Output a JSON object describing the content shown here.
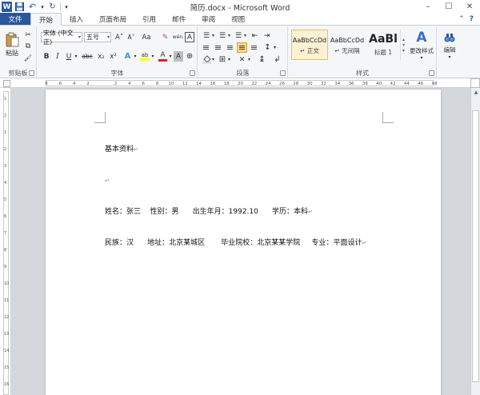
{
  "window": {
    "title": "简历.docx - Microsoft Word",
    "controls": {
      "minimize": "–",
      "maximize": "☐",
      "close": "✕"
    }
  },
  "qat": {
    "app_icon": "W",
    "save_icon": "💾",
    "undo_icon": "↶",
    "redo_icon": "↻",
    "more_icon": "▾"
  },
  "tabs": [
    {
      "label": "文件"
    },
    {
      "label": "开始"
    },
    {
      "label": "插入"
    },
    {
      "label": "页面布局"
    },
    {
      "label": "引用"
    },
    {
      "label": "邮件"
    },
    {
      "label": "审阅"
    },
    {
      "label": "视图"
    }
  ],
  "tab_right": {
    "minimize_ribbon": "⌃",
    "help": "?"
  },
  "ribbon": {
    "clipboard": {
      "label": "剪贴板",
      "paste_label": "粘贴",
      "cut_icon": "✂",
      "copy_icon": "⧉",
      "format_painter_icon": "🖌"
    },
    "font": {
      "label": "字体",
      "font_name": "宋体 (中文正)",
      "font_size": "五号",
      "grow": "A˄",
      "shrink": "A˅",
      "change_case": "Aa",
      "clear": "✎",
      "phonetic": "wén",
      "border_char": "A",
      "bold": "B",
      "italic": "I",
      "underline": "U",
      "strike": "abc",
      "subscript": "x₂",
      "superscript": "x²",
      "text_effect": "A",
      "highlight": "ab",
      "font_color": "A",
      "shade": "A",
      "encircle": "⊕"
    },
    "paragraph": {
      "label": "段落",
      "bullets": "☰",
      "numbering": "☰",
      "multilevel": "☰",
      "decrease_indent": "⇤",
      "increase_indent": "⇥",
      "sort": "A↓",
      "show_marks": "¶",
      "align_left": "≡",
      "align_center": "≡",
      "align_right": "≡",
      "justify": "≡",
      "distributed": "≡",
      "line_spacing": "↕",
      "shading": "🪣",
      "borders": "⊞",
      "asian_layout": "✕",
      "sort2": "↨",
      "rtl": "↲"
    },
    "styles": {
      "label": "样式",
      "items": [
        {
          "sample": "AaBbCcDd",
          "name": "↵ 正文"
        },
        {
          "sample": "AaBbCcDd",
          "name": "↵ 无间隔"
        },
        {
          "sample": "AaBl",
          "name": "标题 1"
        }
      ],
      "change_styles": "更改样式",
      "change_styles_icon": "A"
    },
    "editing": {
      "label": "编辑",
      "icon": "🔭"
    }
  },
  "ruler": {
    "ticks": [
      "8",
      "6",
      "4",
      "2",
      "",
      "2",
      "4",
      "6",
      "8",
      "10",
      "12",
      "14",
      "16",
      "18",
      "20",
      "22",
      "24",
      "26",
      "28",
      "30",
      "32",
      "34",
      "36",
      "38",
      "40",
      "42",
      "44",
      "46",
      "48"
    ]
  },
  "vruler": {
    "ticks": [
      "1",
      "2",
      "1",
      "2",
      "3",
      "4",
      "5",
      "6",
      "7",
      "8",
      "9",
      "10",
      "11",
      "12",
      "13",
      "14",
      "15",
      "16"
    ]
  },
  "document": {
    "lines": [
      "基本资料",
      "",
      "姓名：张三    性别：男      出生年月：1992.10      学历：本科",
      "民族：汉      地址：北京某城区       毕业院校：北京某某学院     专业：平面设计"
    ],
    "para_mark": "↵"
  },
  "scrollbar": {
    "up_arrow": "▲"
  }
}
